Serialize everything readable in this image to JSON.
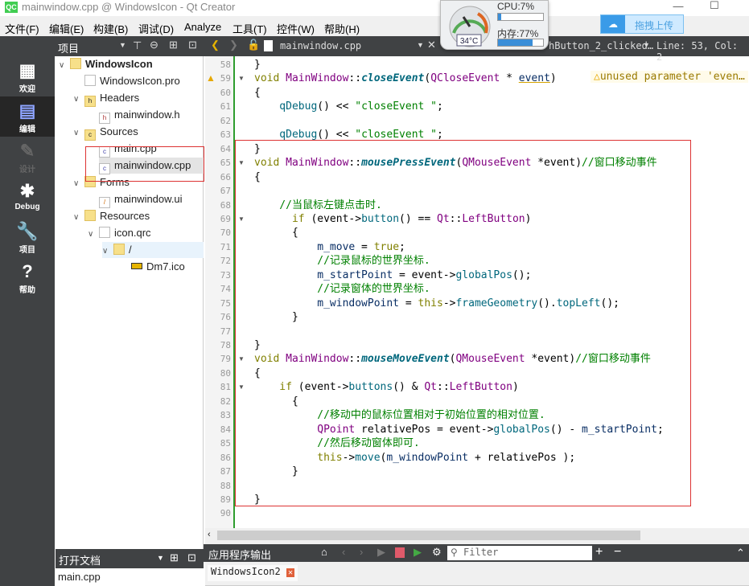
{
  "window": {
    "title": "mainwindow.cpp @ WindowsIcon - Qt Creator",
    "app_icon": "QC"
  },
  "menu": [
    "文件(F)",
    "编辑(E)",
    "构建(B)",
    "调试(D)",
    "Analyze",
    "工具(T)",
    "控件(W)",
    "帮助(H)"
  ],
  "toolbar": {
    "panel_label": "项目",
    "open_file": "mainwindow.cpp",
    "symbol": "hButton_2_clicked…",
    "position": "Line: 53, Col: 2"
  },
  "monitor": {
    "cpu": "CPU:7%",
    "cpu_value": 7,
    "mem": "内存:77%",
    "mem_value": 77,
    "temp": "34°C"
  },
  "upload_button": "拖拽上传",
  "modes": [
    {
      "label": "欢迎",
      "icon": "grid-icon"
    },
    {
      "label": "编辑",
      "icon": "edit-icon"
    },
    {
      "label": "设计",
      "icon": "pencil-icon"
    },
    {
      "label": "Debug",
      "icon": "bug-icon"
    },
    {
      "label": "项目",
      "icon": "wrench-icon"
    },
    {
      "label": "帮助",
      "icon": "help-icon"
    }
  ],
  "tree": [
    {
      "label": "WindowsIcon",
      "bold": true
    },
    {
      "label": "WindowsIcon.pro"
    },
    {
      "label": "Headers"
    },
    {
      "label": "mainwindow.h"
    },
    {
      "label": "Sources"
    },
    {
      "label": "main.cpp"
    },
    {
      "label": "mainwindow.cpp"
    },
    {
      "label": "Forms"
    },
    {
      "label": "mainwindow.ui"
    },
    {
      "label": "Resources"
    },
    {
      "label": "icon.qrc"
    },
    {
      "label": "/"
    },
    {
      "label": "Dm7.ico"
    }
  ],
  "open_docs": {
    "title": "打开文档",
    "items": [
      "main.cpp"
    ]
  },
  "editor": {
    "warning": "unused parameter 'even…",
    "lines": [
      {
        "n": 58,
        "t": [
          [
            "}",
            "pl"
          ]
        ]
      },
      {
        "n": 59,
        "t": [
          [
            "void ",
            "kw"
          ],
          [
            "MainWindow",
            "ty"
          ],
          [
            "::",
            "pl"
          ],
          [
            "closeEvent",
            "fn"
          ],
          [
            "(",
            "pl"
          ],
          [
            "QCloseEvent",
            "ty"
          ],
          [
            " * ",
            "pl"
          ],
          [
            "event",
            "pa"
          ],
          [
            ")",
            "pl"
          ]
        ]
      },
      {
        "n": 60,
        "t": [
          [
            "{",
            "pl"
          ]
        ]
      },
      {
        "n": 61,
        "t": [
          [
            "    qDebug",
            "fc"
          ],
          [
            "() << ",
            "pl"
          ],
          [
            "\"closeEvent \"",
            "st"
          ],
          [
            ";",
            "pl"
          ]
        ]
      },
      {
        "n": 62,
        "t": []
      },
      {
        "n": 63,
        "t": [
          [
            "    qDebug",
            "fc"
          ],
          [
            "() << ",
            "pl"
          ],
          [
            "\"closeEvent \"",
            "st"
          ],
          [
            ";",
            "pl"
          ]
        ]
      },
      {
        "n": 64,
        "t": [
          [
            "}",
            "pl"
          ]
        ]
      },
      {
        "n": 65,
        "t": [
          [
            "void ",
            "kw"
          ],
          [
            "MainWindow",
            "ty"
          ],
          [
            "::",
            "pl"
          ],
          [
            "mousePressEvent",
            "fn"
          ],
          [
            "(",
            "pl"
          ],
          [
            "QMouseEvent",
            "ty"
          ],
          [
            " *event)",
            "pl"
          ],
          [
            "//窗口移动事件",
            "cm"
          ]
        ]
      },
      {
        "n": 66,
        "t": [
          [
            "{",
            "pl"
          ]
        ]
      },
      {
        "n": 67,
        "t": []
      },
      {
        "n": 68,
        "t": [
          [
            "    //当鼠标左键点击时.",
            "cm"
          ]
        ]
      },
      {
        "n": 69,
        "t": [
          [
            "      if ",
            "kw"
          ],
          [
            "(event->",
            "pl"
          ],
          [
            "button",
            "fc"
          ],
          [
            "() == ",
            "pl"
          ],
          [
            "Qt",
            "ty"
          ],
          [
            "::",
            "pl"
          ],
          [
            "LeftButton",
            "ty"
          ],
          [
            ")",
            "pl"
          ]
        ]
      },
      {
        "n": 70,
        "t": [
          [
            "      {",
            "pl"
          ]
        ]
      },
      {
        "n": 71,
        "t": [
          [
            "          m_move",
            "mb"
          ],
          [
            " = ",
            "pl"
          ],
          [
            "true",
            "kw"
          ],
          [
            ";",
            "pl"
          ]
        ]
      },
      {
        "n": 72,
        "t": [
          [
            "          //记录鼠标的世界坐标.",
            "cm"
          ]
        ]
      },
      {
        "n": 73,
        "t": [
          [
            "          m_startPoint",
            "mb"
          ],
          [
            " = event->",
            "pl"
          ],
          [
            "globalPos",
            "fc"
          ],
          [
            "();",
            "pl"
          ]
        ]
      },
      {
        "n": 74,
        "t": [
          [
            "          //记录窗体的世界坐标.",
            "cm"
          ]
        ]
      },
      {
        "n": 75,
        "t": [
          [
            "          m_windowPoint",
            "mb"
          ],
          [
            " = ",
            "pl"
          ],
          [
            "this",
            "kw"
          ],
          [
            "->",
            "pl"
          ],
          [
            "frameGeometry",
            "fc"
          ],
          [
            "().",
            "pl"
          ],
          [
            "topLeft",
            "fc"
          ],
          [
            "();",
            "pl"
          ]
        ]
      },
      {
        "n": 76,
        "t": [
          [
            "      }",
            "pl"
          ]
        ]
      },
      {
        "n": 77,
        "t": []
      },
      {
        "n": 78,
        "t": [
          [
            "}",
            "pl"
          ]
        ]
      },
      {
        "n": 79,
        "t": [
          [
            "void ",
            "kw"
          ],
          [
            "MainWindow",
            "ty"
          ],
          [
            "::",
            "pl"
          ],
          [
            "mouseMoveEvent",
            "fn"
          ],
          [
            "(",
            "pl"
          ],
          [
            "QMouseEvent",
            "ty"
          ],
          [
            " *event)",
            "pl"
          ],
          [
            "//窗口移动事件",
            "cm"
          ]
        ]
      },
      {
        "n": 80,
        "t": [
          [
            "{",
            "pl"
          ]
        ]
      },
      {
        "n": 81,
        "t": [
          [
            "    if ",
            "kw"
          ],
          [
            "(event->",
            "pl"
          ],
          [
            "buttons",
            "fc"
          ],
          [
            "() & ",
            "pl"
          ],
          [
            "Qt",
            "ty"
          ],
          [
            "::",
            "pl"
          ],
          [
            "LeftButton",
            "ty"
          ],
          [
            ")",
            "pl"
          ]
        ]
      },
      {
        "n": 82,
        "t": [
          [
            "      {",
            "pl"
          ]
        ]
      },
      {
        "n": 83,
        "t": [
          [
            "          //移动中的鼠标位置相对于初始位置的相对位置.",
            "cm"
          ]
        ]
      },
      {
        "n": 84,
        "t": [
          [
            "          QPoint",
            "ty"
          ],
          [
            " relativePos = event->",
            "pl"
          ],
          [
            "globalPos",
            "fc"
          ],
          [
            "() - ",
            "pl"
          ],
          [
            "m_startPoint",
            "mb"
          ],
          [
            ";",
            "pl"
          ]
        ]
      },
      {
        "n": 85,
        "t": [
          [
            "          //然后移动窗体即可.",
            "cm"
          ]
        ]
      },
      {
        "n": 86,
        "t": [
          [
            "          this",
            "kw"
          ],
          [
            "->",
            "pl"
          ],
          [
            "move",
            "fc"
          ],
          [
            "(",
            "pl"
          ],
          [
            "m_windowPoint",
            "mb"
          ],
          [
            " + relativePos );",
            "pl"
          ]
        ]
      },
      {
        "n": 87,
        "t": [
          [
            "      }",
            "pl"
          ]
        ]
      },
      {
        "n": 88,
        "t": []
      },
      {
        "n": 89,
        "t": [
          [
            "}",
            "pl"
          ]
        ]
      },
      {
        "n": 90,
        "t": []
      }
    ]
  },
  "output": {
    "title": "应用程序输出",
    "filter_placeholder": "Filter",
    "tab": "WindowsIcon2"
  }
}
